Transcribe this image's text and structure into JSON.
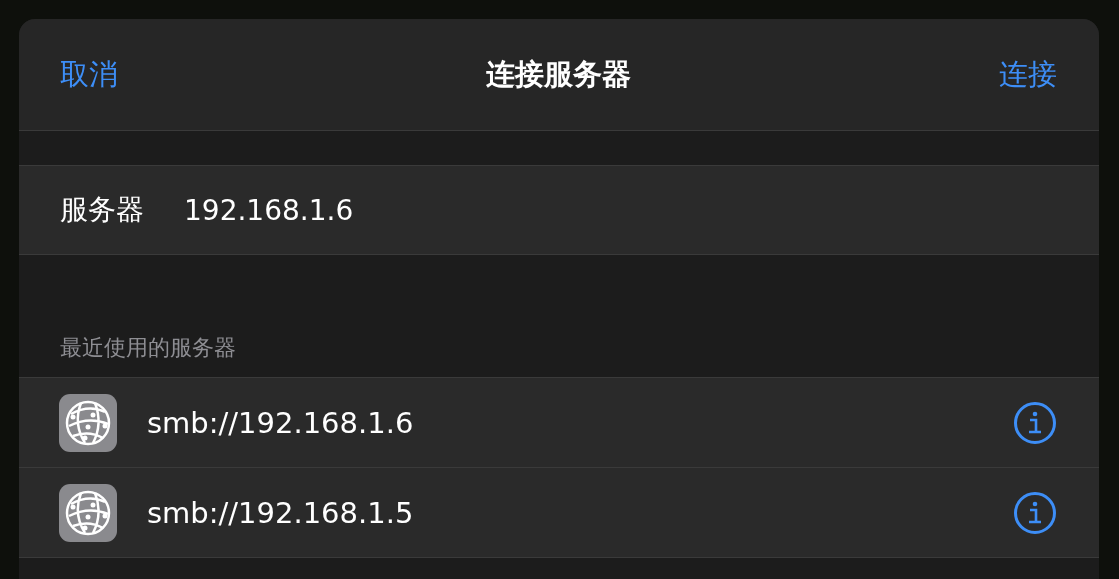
{
  "header": {
    "cancel": "取消",
    "title": "连接服务器",
    "connect": "连接"
  },
  "server_field": {
    "label": "服务器",
    "value": "192.168.1.6"
  },
  "recent": {
    "heading": "最近使用的服务器",
    "items": [
      {
        "address": "smb://192.168.1.6"
      },
      {
        "address": "smb://192.168.1.5"
      }
    ]
  }
}
